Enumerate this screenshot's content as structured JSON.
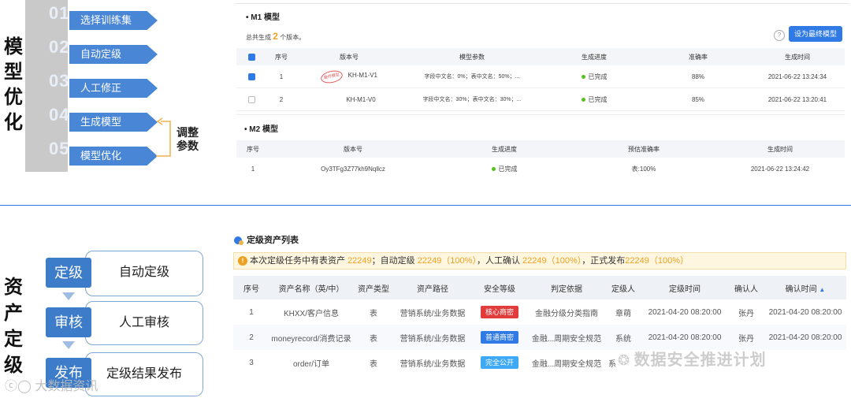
{
  "opt": {
    "title_chars": [
      "模",
      "型",
      "优",
      "化"
    ],
    "steps": [
      {
        "num": "01",
        "label": "选择训练集"
      },
      {
        "num": "02",
        "label": "自动定级"
      },
      {
        "num": "03",
        "label": "人工修正"
      },
      {
        "num": "04",
        "label": "生成模型"
      },
      {
        "num": "05",
        "label": "模型优化"
      }
    ],
    "adjust_line1": "调整",
    "adjust_line2": "参数"
  },
  "m1": {
    "title": "M1 模型",
    "summary_prefix": "总共生成",
    "summary_count": "2",
    "summary_suffix": "个版本。",
    "help": "?",
    "set_final_button": "设为最终模型",
    "columns": [
      "序号",
      "版本号",
      "模型参数",
      "生成进度",
      "准确率",
      "生成时间"
    ],
    "rows": [
      {
        "idx": "1",
        "stamp": "最终模型",
        "version": "KH-M1-V1",
        "params": "字段中文名：0%；表中文名：50%；...",
        "progress": "已完成",
        "accuracy": "88%",
        "time": "2021-06-22 13:24:34",
        "checked": true
      },
      {
        "idx": "2",
        "stamp": "",
        "version": "KH-M1-V0",
        "params": "字段中文名：30%；表中文名：30%；...",
        "progress": "已完成",
        "accuracy": "85%",
        "time": "2021-06-22 13:20:41",
        "checked": false
      }
    ]
  },
  "m2": {
    "title": "M2 模型",
    "columns": [
      "序号",
      "版本号",
      "生成进度",
      "预估准确率",
      "生成时间"
    ],
    "rows": [
      {
        "idx": "1",
        "version": "Oy3TFg3Z77kh9Nqllcz",
        "progress": "已完成",
        "accuracy": "表:100%",
        "time": "2021-06-22 13:24:42"
      }
    ]
  },
  "asset": {
    "title_chars": [
      "资",
      "产",
      "定",
      "级"
    ],
    "flow": [
      {
        "tag": "定级",
        "label": "自动定级"
      },
      {
        "tag": "审核",
        "label": "人工审核"
      },
      {
        "tag": "发布",
        "label": "定级结果发布"
      }
    ],
    "list_title": "定级资产列表",
    "warn_prefix": "本次定级任务中有表资产",
    "warn_n1": "22249",
    "warn_mid1": "；自动定级",
    "warn_n2": "22249（100%）",
    "warn_mid2": "，人工确认",
    "warn_n3": "22249（100%）",
    "warn_mid3": "，正式发布",
    "warn_n4": "22249（100%）",
    "columns": [
      "序号",
      "资产名称（英/中）",
      "资产类型",
      "资产路径",
      "安全等级",
      "判定依据",
      "定级人",
      "定级时间",
      "确认人",
      "确认时间"
    ],
    "sort_icon": "▲",
    "rows": [
      {
        "idx": "1",
        "name": "KHXX/客户信息",
        "type": "表",
        "path": "营销系统/业务数据",
        "level": "核心商密",
        "level_color": "#e23b3b",
        "basis": "金融分级分类指南",
        "rater": "章萌",
        "rate_time": "2021-04-20 08:20:00",
        "confirmer": "张丹",
        "confirm_time": "2021-04-20 08:20:00"
      },
      {
        "idx": "2",
        "name": "moneyrecord/消费记录",
        "type": "表",
        "path": "营销系统/业务数据",
        "level": "普通商密",
        "level_color": "#2f7ae5",
        "basis": "金融...周期安全规范",
        "rater": "系统",
        "rate_time": "2021-04-20 08:20:00",
        "confirmer": "张丹",
        "confirm_time": "2021-04-20 08:20:00"
      },
      {
        "idx": "3",
        "name": "order/订单",
        "type": "表",
        "path": "营销系统/业务数据",
        "level": "完全公开",
        "level_color": "#3fa9f5",
        "basis": "金融...周期安全规范",
        "rater": "系",
        "rate_time": "",
        "confirmer": "",
        "confirm_time": ""
      }
    ]
  },
  "watermark_right": "数据安全推进计划",
  "watermark_left": "大数据资讯"
}
